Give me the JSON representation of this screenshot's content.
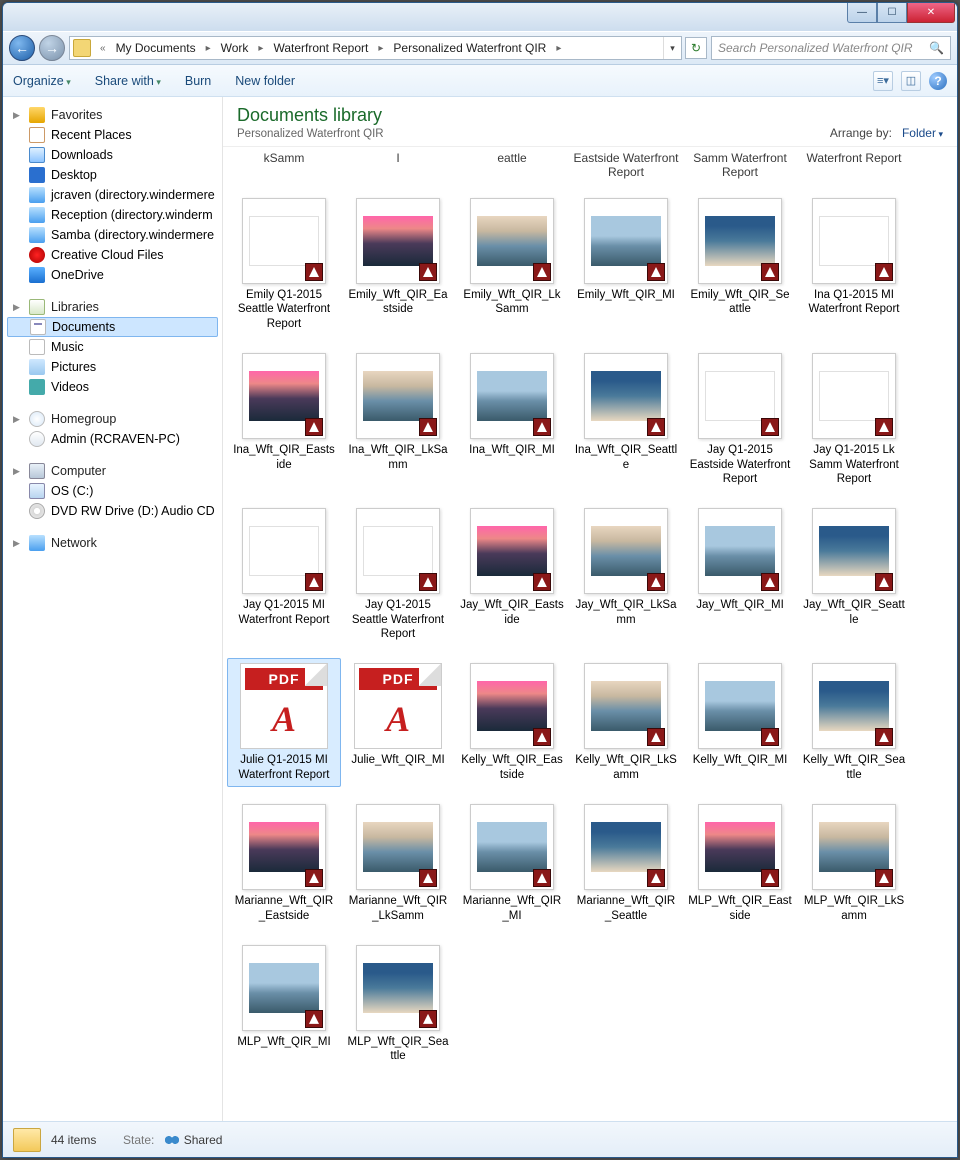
{
  "window": {
    "title": ""
  },
  "nav": {
    "breadcrumb_prefix": "«",
    "crumbs": [
      "My Documents",
      "Work",
      "Waterfront Report",
      "Personalized Waterfront QIR"
    ],
    "search_placeholder": "Search Personalized Waterfront QIR"
  },
  "toolbar": {
    "organize": "Organize",
    "share_with": "Share with",
    "burn": "Burn",
    "new_folder": "New folder"
  },
  "sidebar": {
    "favorites": {
      "label": "Favorites",
      "items": [
        {
          "label": "Recent Places",
          "icon": "place"
        },
        {
          "label": "Downloads",
          "icon": "dl"
        },
        {
          "label": "Desktop",
          "icon": "desk"
        },
        {
          "label": "jcraven (directory.windermere",
          "icon": "net"
        },
        {
          "label": "Reception (directory.winderm",
          "icon": "net"
        },
        {
          "label": "Samba (directory.windermere",
          "icon": "net"
        },
        {
          "label": "Creative Cloud Files",
          "icon": "cc"
        },
        {
          "label": "OneDrive",
          "icon": "od"
        }
      ]
    },
    "libraries": {
      "label": "Libraries",
      "items": [
        {
          "label": "Documents",
          "icon": "doc",
          "selected": true
        },
        {
          "label": "Music",
          "icon": "mus"
        },
        {
          "label": "Pictures",
          "icon": "pic"
        },
        {
          "label": "Videos",
          "icon": "vid"
        }
      ]
    },
    "homegroup": {
      "label": "Homegroup",
      "items": [
        {
          "label": "Admin (RCRAVEN-PC)",
          "icon": "usr"
        }
      ]
    },
    "computer": {
      "label": "Computer",
      "items": [
        {
          "label": "OS (C:)",
          "icon": "drive"
        },
        {
          "label": "DVD RW Drive (D:) Audio CD",
          "icon": "cd"
        }
      ]
    },
    "network": {
      "label": "Network"
    }
  },
  "library_header": {
    "title": "Documents library",
    "subtitle": "Personalized Waterfront QIR",
    "arrange_label": "Arrange by:",
    "arrange_value": "Folder"
  },
  "col_headers": [
    "kSamm",
    "I",
    "eattle",
    "Eastside Waterfront Report",
    "Samm Waterfront Report",
    "Waterfront Report"
  ],
  "files": [
    {
      "name": "Emily Q1-2015 Seattle Waterfront Report",
      "thumb": "doc"
    },
    {
      "name": "Emily_Wft_QIR_Eastside",
      "thumb": "sunset"
    },
    {
      "name": "Emily_Wft_QIR_LkSamm",
      "thumb": "lake"
    },
    {
      "name": "Emily_Wft_QIR_MI",
      "thumb": "house"
    },
    {
      "name": "Emily_Wft_QIR_Seattle",
      "thumb": "interior"
    },
    {
      "name": "Ina Q1-2015 MI Waterfront Report",
      "thumb": "doc"
    },
    {
      "name": "Ina_Wft_QIR_Eastside",
      "thumb": "sunset"
    },
    {
      "name": "Ina_Wft_QIR_LkSamm",
      "thumb": "lake"
    },
    {
      "name": "Ina_Wft_QIR_MI",
      "thumb": "house"
    },
    {
      "name": "Ina_Wft_QIR_Seattle",
      "thumb": "interior"
    },
    {
      "name": "Jay Q1-2015 Eastside Waterfront Report",
      "thumb": "doc"
    },
    {
      "name": "Jay Q1-2015 Lk Samm Waterfront Report",
      "thumb": "doc"
    },
    {
      "name": "Jay Q1-2015 MI Waterfront Report",
      "thumb": "doc"
    },
    {
      "name": "Jay Q1-2015 Seattle Waterfront Report",
      "thumb": "doc"
    },
    {
      "name": "Jay_Wft_QIR_Eastside",
      "thumb": "sunset"
    },
    {
      "name": "Jay_Wft_QIR_LkSamm",
      "thumb": "lake"
    },
    {
      "name": "Jay_Wft_QIR_MI",
      "thumb": "house"
    },
    {
      "name": "Jay_Wft_QIR_Seattle",
      "thumb": "interior"
    },
    {
      "name": "Julie Q1-2015 MI Waterfront Report",
      "thumb": "pdf",
      "selected": true
    },
    {
      "name": "Julie_Wft_QIR_MI",
      "thumb": "pdf"
    },
    {
      "name": "Kelly_Wft_QIR_Eastside",
      "thumb": "sunset"
    },
    {
      "name": "Kelly_Wft_QIR_LkSamm",
      "thumb": "lake"
    },
    {
      "name": "Kelly_Wft_QIR_MI",
      "thumb": "house"
    },
    {
      "name": "Kelly_Wft_QIR_Seattle",
      "thumb": "interior"
    },
    {
      "name": "Marianne_Wft_QIR_Eastside",
      "thumb": "sunset"
    },
    {
      "name": "Marianne_Wft_QIR_LkSamm",
      "thumb": "lake"
    },
    {
      "name": "Marianne_Wft_QIR_MI",
      "thumb": "house"
    },
    {
      "name": "Marianne_Wft_QIR_Seattle",
      "thumb": "interior"
    },
    {
      "name": "MLP_Wft_QIR_Eastside",
      "thumb": "sunset"
    },
    {
      "name": "MLP_Wft_QIR_LkSamm",
      "thumb": "lake"
    },
    {
      "name": "MLP_Wft_QIR_MI",
      "thumb": "house"
    },
    {
      "name": "MLP_Wft_QIR_Seattle",
      "thumb": "interior"
    }
  ],
  "status": {
    "count_text": "44 items",
    "state_label": "State:",
    "state_value": "Shared"
  },
  "pdf_label": "PDF"
}
